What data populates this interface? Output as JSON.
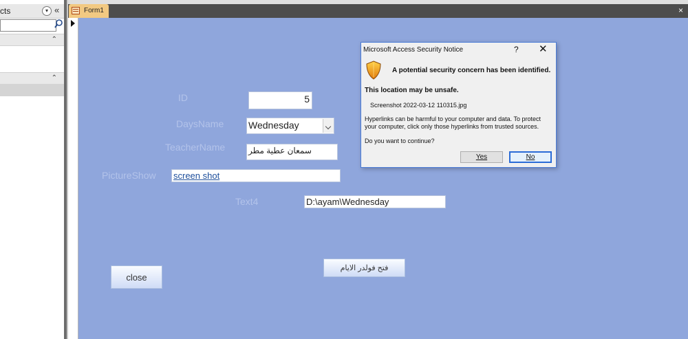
{
  "nav": {
    "title": "cts",
    "dropdown_icon": "chevron-down-circle-icon",
    "collapse_icon": "double-chevron-left-icon",
    "collapse_glyph": "«",
    "search_value": "",
    "search_icon": "search-icon",
    "group_chevron": "⌃"
  },
  "window": {
    "tab_label": "Form1",
    "close_glyph": "×"
  },
  "form": {
    "id_label": "ID",
    "id_value": "5",
    "days_label": "DaysName",
    "days_value": "Wednesday",
    "teacher_label": "TeacherName",
    "teacher_value": "سمعان عطية مطر",
    "picture_label": "PictureShow",
    "picture_link": "screen shot",
    "text4_label": "Text4",
    "text4_value": "D:\\ayam\\Wednesday",
    "close_button": "close",
    "folder_button": "فتح فولدر الايام"
  },
  "dialog": {
    "title": "Microsoft Access Security Notice",
    "help_glyph": "?",
    "close_glyph": "✕",
    "heading": "A potential security concern has been identified.",
    "subheading": "This location may be unsafe.",
    "file_name": "Screenshot 2022-03-12 110315.jpg",
    "body_line1": "Hyperlinks can be harmful to your computer and data. To protect",
    "body_line2": "your computer, click only those hyperlinks from trusted sources.",
    "question": "Do you want to continue?",
    "yes_label": "Yes",
    "no_label": "No",
    "shield_colors": {
      "top": "#ffd24a",
      "bottom": "#e07a0c"
    }
  },
  "colors": {
    "form_background": "#8fa6dc",
    "tab_background": "#f2c982",
    "link": "#1d4e9b"
  }
}
